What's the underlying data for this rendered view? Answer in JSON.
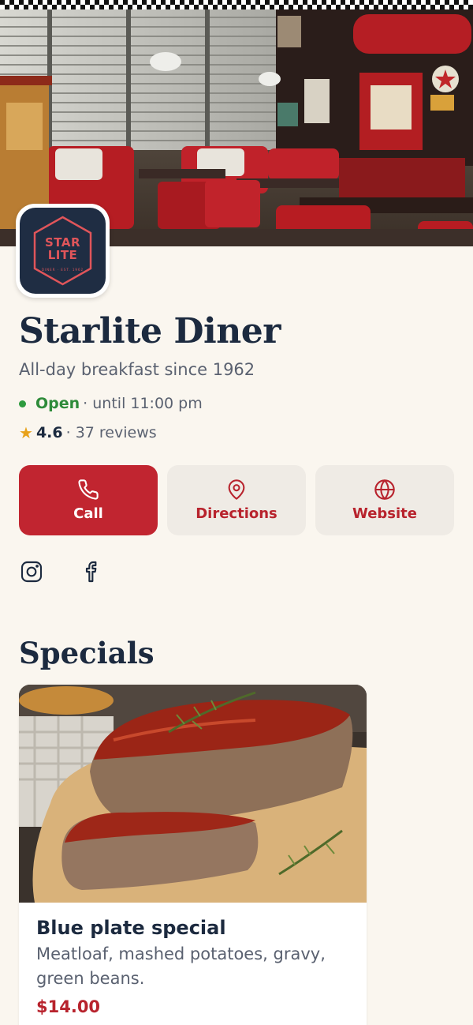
{
  "restaurant": {
    "name": "Starlite Diner",
    "tagline": "All-day breakfast since 1962",
    "status": "Open",
    "hours": "· until 11:00 pm",
    "rating": "4.6",
    "reviews": "· 37 reviews",
    "logo": {
      "line1": "STAR",
      "line2": "LITE",
      "sub": "DINER · EST. 1962"
    }
  },
  "actions": {
    "call": "Call",
    "directions": "Directions",
    "website": "Website"
  },
  "social": {
    "instagram_icon": "instagram-icon",
    "facebook_icon": "facebook-icon"
  },
  "specials": {
    "heading": "Specials",
    "items": [
      {
        "title": "Blue plate special",
        "description": "Meatloaf, mashed potatoes, gravy, green beans.",
        "price": "$14.00"
      }
    ]
  },
  "colors": {
    "brand_red": "#c12530",
    "navy": "#1c2a3f",
    "open_green": "#2e8b3a",
    "star": "#e8a21a",
    "background": "#faf6ef"
  }
}
